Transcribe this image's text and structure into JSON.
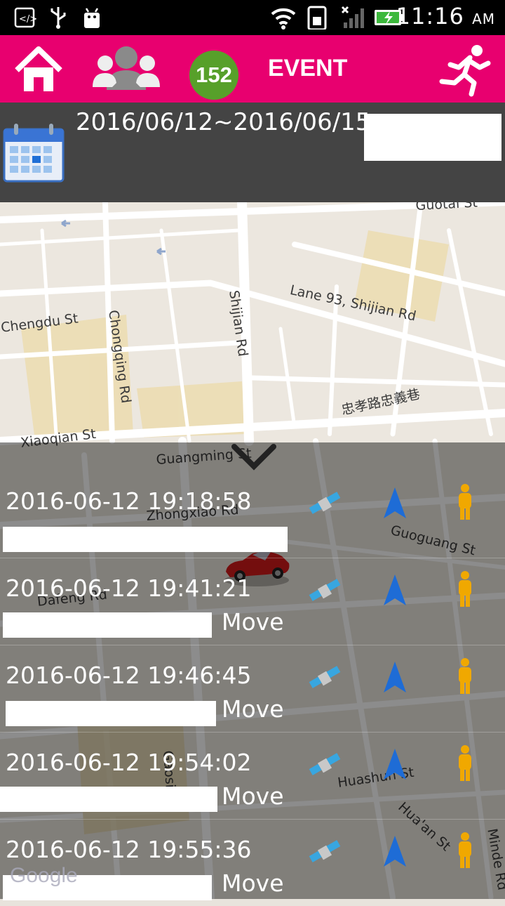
{
  "statusbar": {
    "time": "11:16",
    "ampm": "AM"
  },
  "header": {
    "badge_count": "152",
    "event_label": "EVENT",
    "icons": [
      "home-icon",
      "group-icon",
      "runner-icon"
    ]
  },
  "datebar": {
    "date_range": "2016/06/12~2016/06/15",
    "icon": "calendar-icon"
  },
  "map": {
    "labels": [
      "Guotai St",
      "Lane 93, Shijian Rd",
      "Chengdu St",
      "Chongqing Rd",
      "Shijian Rd",
      "忠孝路忠義巷",
      "Xiaoqian St",
      "Guangming St",
      "Zhongxiao Rd",
      "Guoguang St",
      "Dafeng Rd",
      "Huashun St",
      "Hua'an St",
      "Minde Rd",
      "Gaosi Rd"
    ],
    "vehicle_icon": "car-icon",
    "attribution": "Google"
  },
  "events": [
    {
      "timestamp": "2016-06-12 19:18:58",
      "status": ""
    },
    {
      "timestamp": "2016-06-12 19:41:21",
      "status": "Move"
    },
    {
      "timestamp": "2016-06-12 19:46:45",
      "status": "Move"
    },
    {
      "timestamp": "2016-06-12 19:54:02",
      "status": "Move"
    },
    {
      "timestamp": "2016-06-12 19:55:36",
      "status": "Move"
    }
  ],
  "colors": {
    "accent": "#e8006f",
    "badge": "#57a02a",
    "datebar": "#444444"
  }
}
